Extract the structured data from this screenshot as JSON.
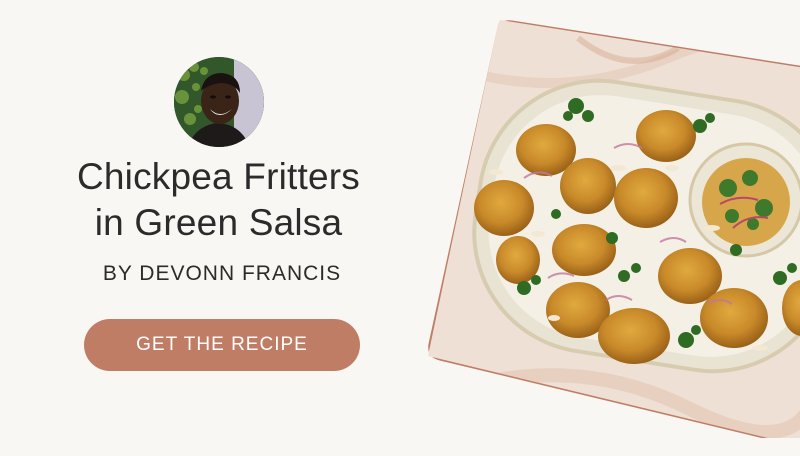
{
  "recipe": {
    "title_line1": "Chickpea Fritters",
    "title_line2": "in Green Salsa",
    "byline": "BY DEVONN FRANCIS",
    "cta_label": "GET THE RECIPE"
  },
  "colors": {
    "background": "#f8f7f3",
    "accent": "#c07d66",
    "text": "#2b2b2b"
  },
  "icons": {
    "avatar": "chef-portrait",
    "photo": "fritters-dish-photo"
  }
}
